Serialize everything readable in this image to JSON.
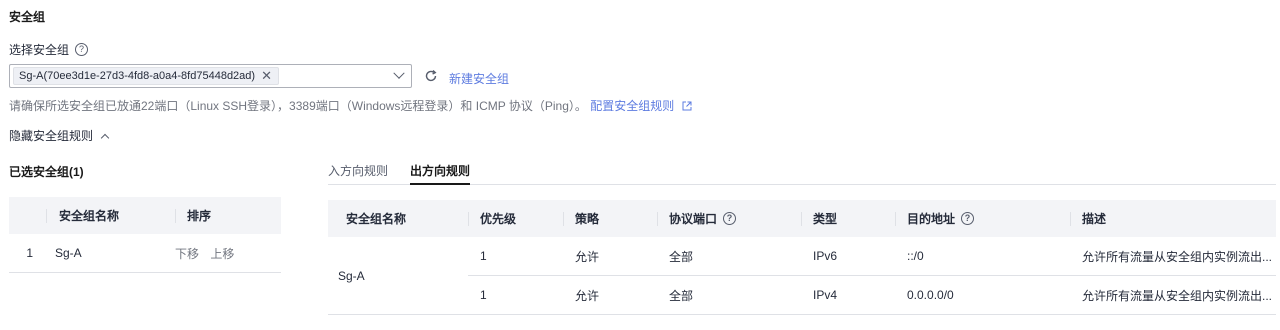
{
  "title": "安全组",
  "select_label": "选择安全组",
  "help_glyph": "?",
  "selected_tag": "Sg-A(70ee3d1e-27d3-4fd8-a0a4-8fd75448d2ad)",
  "new_sg_link": "新建安全组",
  "hint_text": "请确保所选安全组已放通22端口（Linux SSH登录），3389端口（Windows远程登录）和 ICMP 协议（Ping）。",
  "hint_link": "配置安全组规则",
  "hide_rules": "隐藏安全组规则",
  "selected_title": "已选安全组(1)",
  "tabs": [
    {
      "label": "入方向规则",
      "active": false
    },
    {
      "label": "出方向规则",
      "active": true
    }
  ],
  "left_table": {
    "headers": [
      "安全组名称",
      "排序"
    ],
    "rows": [
      {
        "index": "1",
        "name": "Sg-A",
        "down": "下移",
        "up": "上移"
      }
    ]
  },
  "right_table": {
    "headers": [
      "安全组名称",
      "优先级",
      "策略",
      "协议端口",
      "类型",
      "目的地址",
      "描述"
    ],
    "group_name": "Sg-A",
    "rows": [
      {
        "priority": "1",
        "policy": "允许",
        "port": "全部",
        "type": "IPv6",
        "dest": "::/0",
        "desc": "允许所有流量从安全组内实例流出..."
      },
      {
        "priority": "1",
        "policy": "允许",
        "port": "全部",
        "type": "IPv4",
        "dest": "0.0.0.0/0",
        "desc": "允许所有流量从安全组内实例流出..."
      }
    ]
  },
  "colors": {
    "link": "#5e7ce0",
    "header_bg": "#f3f4f7",
    "border": "#dfe1e6"
  }
}
